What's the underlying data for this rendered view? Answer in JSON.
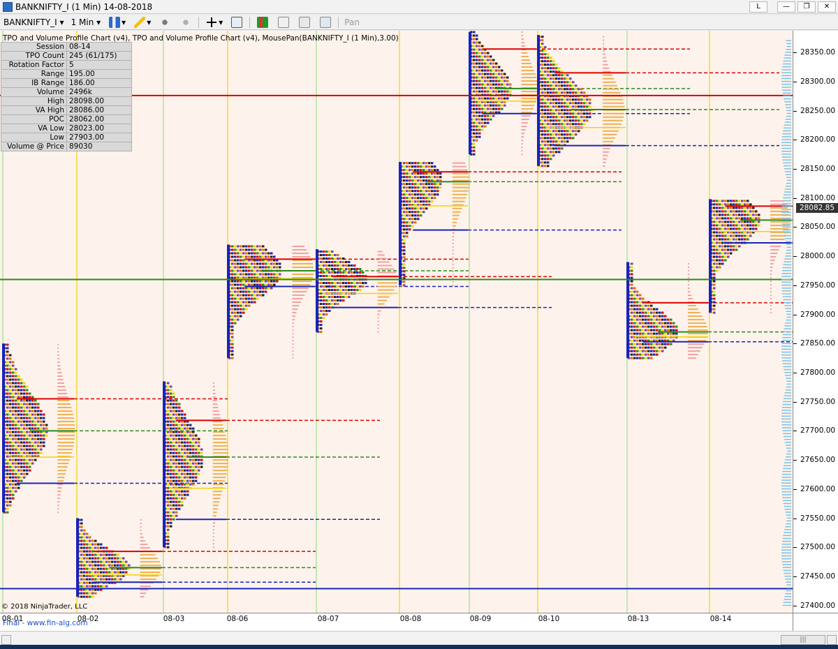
{
  "window": {
    "title": "BANKNIFTY_I (1 Min)  14-08-2018",
    "buttons": {
      "layout": "L",
      "minimize": "—",
      "restore": "❐",
      "close": "✕"
    }
  },
  "toolbar": {
    "instrument": "BANKNIFTY_I",
    "interval": "1 Min",
    "pan_label": "Pan",
    "icons": [
      "bar-type-icon",
      "pencil-icon",
      "draw-tools-icon",
      "crosshair-icon",
      "zoom-icon",
      "indicators-icon",
      "strategies-icon",
      "chart-trader-icon",
      "properties-icon"
    ]
  },
  "chart": {
    "header": "TPO and Volume Profile Chart (v4),  TPO and Volume Profile Chart (v4), MousePan(BANKNIFTY_I (1 Min),3.00)",
    "stats": [
      {
        "label": "Session",
        "value": "08-14"
      },
      {
        "label": "TPO Count",
        "value": "245 (61/175)"
      },
      {
        "label": "Rotation Factor",
        "value": "5"
      },
      {
        "label": "Range",
        "value": "195.00"
      },
      {
        "label": "IB Range",
        "value": "186.00"
      },
      {
        "label": "Volume",
        "value": "2496k"
      },
      {
        "label": "High",
        "value": "28098.00"
      },
      {
        "label": "VA High",
        "value": "28086.00"
      },
      {
        "label": "POC",
        "value": "28062.00"
      },
      {
        "label": "VA Low",
        "value": "28023.00"
      },
      {
        "label": "Low",
        "value": "27903.00"
      },
      {
        "label": "Volume @ Price",
        "value": "89030"
      }
    ],
    "current_price": "28082.85",
    "copyright": "© 2018 NinjaTrader, LLC",
    "footer_link": "Final - www.fin-alg.com"
  },
  "chart_data": {
    "type": "tpo-volume-profile",
    "y_ticks": [
      28350,
      28300,
      28250,
      28200,
      28150,
      28100,
      28050,
      28000,
      27950,
      27900,
      27850,
      27800,
      27750,
      27700,
      27650,
      27600,
      27550,
      27500,
      27450,
      27400
    ],
    "y_tick_labels": [
      "28350.00",
      "28300.00",
      "28250.00",
      "28200.00",
      "28150.00",
      "28100.00",
      "28050.00",
      "28000.00",
      "27950.00",
      "27900.00",
      "27850.00",
      "27800.00",
      "27750.00",
      "27700.00",
      "27650.00",
      "27600.00",
      "27550.00",
      "27500.00",
      "27450.00",
      "27400.00"
    ],
    "ylim": [
      27390,
      28385
    ],
    "sessions": [
      "08-01",
      "08-02",
      "08-03",
      "08-06",
      "08-07",
      "08-08",
      "08-09",
      "08-10",
      "08-13",
      "08-14"
    ],
    "profiles": [
      {
        "session": "08-01",
        "low": 27560,
        "high": 27850,
        "poc": 27700,
        "vah": 27755,
        "val": 27610
      },
      {
        "session": "08-02",
        "low": 27415,
        "high": 27550,
        "poc": 27465,
        "vah": 27493,
        "val": 27440
      },
      {
        "session": "08-03",
        "low": 27500,
        "high": 27785,
        "poc": 27655,
        "vah": 27718,
        "val": 27548
      },
      {
        "session": "08-06",
        "low": 27825,
        "high": 28020,
        "poc": 27975,
        "vah": 27995,
        "val": 27948
      },
      {
        "session": "08-07",
        "low": 27870,
        "high": 28012,
        "poc": 27960,
        "vah": 27965,
        "val": 27912
      },
      {
        "session": "08-08",
        "low": 27950,
        "high": 28162,
        "poc": 28128,
        "vah": 28145,
        "val": 28045
      },
      {
        "session": "08-09",
        "low": 28175,
        "high": 28385,
        "poc": 28288,
        "vah": 28356,
        "val": 28245
      },
      {
        "session": "08-10",
        "low": 28155,
        "high": 28380,
        "poc": 28252,
        "vah": 28315,
        "val": 28190
      },
      {
        "session": "08-13",
        "low": 27825,
        "high": 27990,
        "poc": 27870,
        "vah": 27920,
        "val": 27853
      },
      {
        "session": "08-14",
        "low": 27903,
        "high": 28098,
        "poc": 28062,
        "vah": 28086,
        "val": 28023
      }
    ],
    "horizontal_lines": [
      {
        "price": 28276,
        "color": "#dd0000",
        "style": "solid"
      },
      {
        "price": 27960,
        "color": "#2a8a1c",
        "style": "solid"
      },
      {
        "price": 27429,
        "color": "#1a23b8",
        "style": "solid"
      }
    ],
    "colors": {
      "red": "#dd0000",
      "green": "#2a8a1c",
      "blue": "#1a23b8",
      "yellow": "#f7d200",
      "volume_orange": "#f0b050",
      "chart_bg": "#fdf3ec"
    }
  }
}
